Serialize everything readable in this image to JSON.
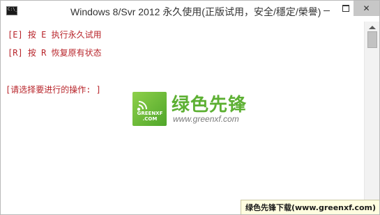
{
  "window": {
    "title": "Windows 8/Svr 2012 永久使用(正版试用，安全/穩定/榮譽)",
    "icon_text": "C:\\_",
    "controls": {
      "minimize": "minimize-icon",
      "maximize": "maximize-icon",
      "close": "✕"
    }
  },
  "console": {
    "lines": [
      "[E] 按 E 执行永久试用",
      "[R] 按 R 恢复原有状态"
    ],
    "prompt": "[请选择要进行的操作: ]"
  },
  "watermark_logo": {
    "brand": "绿色先锋",
    "small_text_line1": "GREENXF",
    "small_text_line2": ".COM",
    "url": "www.greenxf.com",
    "colors": {
      "brand": "#5db033",
      "box": "#6cbf3a"
    }
  },
  "bottom_watermark": {
    "text": "绿色先锋下载(www.greenxf.com)"
  },
  "colors": {
    "console_text": "#b8242a",
    "title_text": "#333333"
  }
}
